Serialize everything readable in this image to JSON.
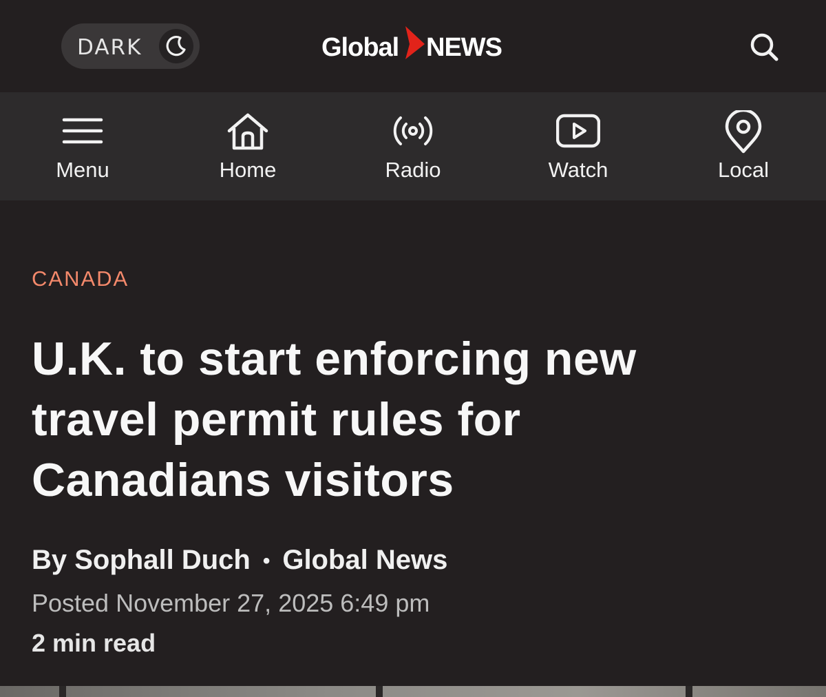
{
  "header": {
    "dark_toggle_label": "DARK",
    "logo_global": "Global",
    "logo_news": "NEWS"
  },
  "nav": {
    "items": [
      {
        "label": "Menu",
        "icon": "hamburger-menu-icon"
      },
      {
        "label": "Home",
        "icon": "home-icon"
      },
      {
        "label": "Radio",
        "icon": "radio-broadcast-icon"
      },
      {
        "label": "Watch",
        "icon": "play-video-icon"
      },
      {
        "label": "Local",
        "icon": "location-pin-icon"
      }
    ]
  },
  "article": {
    "category": "CANADA",
    "headline": "U.K. to start enforcing new travel permit rules for Canadians visitors",
    "author": "By Sophall Duch",
    "byline_separator": "•",
    "source": "Global News",
    "posted": "Posted November 27, 2025 6:49 pm",
    "read_time": "2 min read"
  },
  "colors": {
    "background": "#231f20",
    "nav_background": "#2d2b2c",
    "category_accent": "#f4896b",
    "logo_red": "#e2231a"
  }
}
